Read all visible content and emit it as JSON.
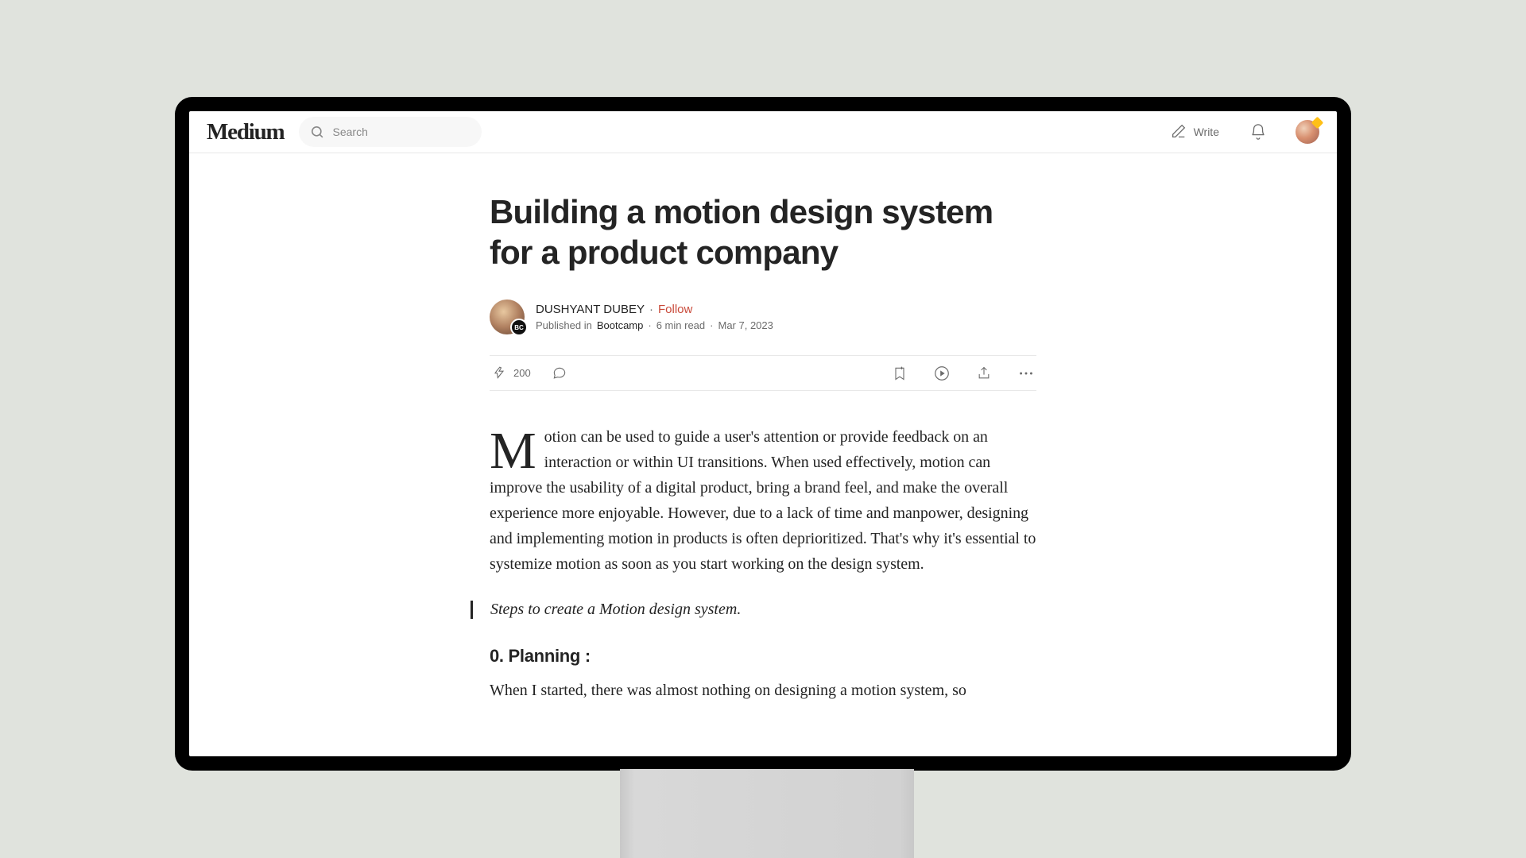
{
  "header": {
    "logo": "Medium",
    "search_placeholder": "Search",
    "write_label": "Write"
  },
  "article": {
    "title": "Building a motion design system for a product company",
    "author": "DUSHYANT DUBEY",
    "follow_label": "Follow",
    "published_in_prefix": "Published in",
    "publication": "Bootcamp",
    "read_time": "6 min read",
    "date": "Mar 7, 2023",
    "clap_count": "200",
    "body_p1": "Motion can be used to guide a user's attention or provide feedback on an interaction or within UI transitions. When used effectively, motion can improve the usability of a digital product, bring a brand feel, and make the overall experience more enjoyable. However, due to a lack of time and manpower, designing and implementing motion in products is often deprioritized. That's why it's essential to systemize motion as soon as you start working on the design system.",
    "quote": "Steps to create a Motion design system.",
    "section_0_title": "0. Planning :",
    "section_0_body": "When I started, there was almost nothing on designing a motion system, so"
  }
}
